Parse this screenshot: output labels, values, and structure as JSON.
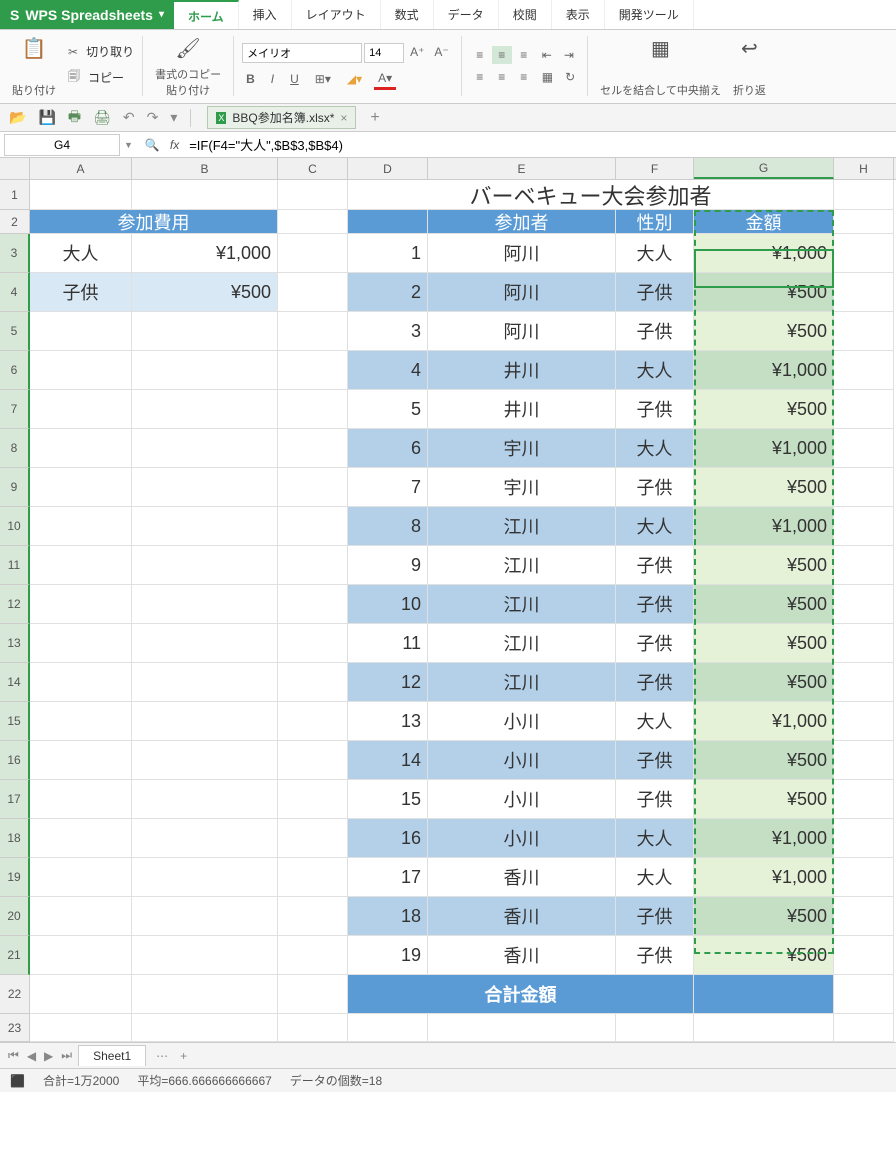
{
  "app": {
    "name": "WPS Spreadsheets"
  },
  "tabs": [
    "ホーム",
    "挿入",
    "レイアウト",
    "数式",
    "データ",
    "校閲",
    "表示",
    "開発ツール"
  ],
  "ribbon": {
    "paste": "貼り付け",
    "cut": "切り取り",
    "copy": "コピー",
    "format_paint": "書式のコピー\n貼り付け",
    "font_name": "メイリオ",
    "font_size": "14",
    "merge": "セルを結合して中央揃え",
    "wrap": "折り返"
  },
  "file": {
    "name": "BBQ参加名簿.xlsx*"
  },
  "namebox": "G4",
  "formula": "=IF(F4=\"大人\",$B$3,$B$4)",
  "col_headers": [
    "A",
    "B",
    "C",
    "D",
    "E",
    "F",
    "G",
    "H"
  ],
  "sheet": {
    "title": "バーベキュー大会参加者",
    "fee_header": "参加費用",
    "fee_rows": [
      {
        "label": "大人",
        "amount": "¥1,000"
      },
      {
        "label": "子供",
        "amount": "¥500"
      }
    ],
    "part_headers": {
      "d": "",
      "e": "参加者",
      "f": "性別",
      "g": "金額"
    },
    "rows": [
      {
        "n": "1",
        "name": "阿川",
        "type": "大人",
        "amt": "¥1,000"
      },
      {
        "n": "2",
        "name": "阿川",
        "type": "子供",
        "amt": "¥500"
      },
      {
        "n": "3",
        "name": "阿川",
        "type": "子供",
        "amt": "¥500"
      },
      {
        "n": "4",
        "name": "井川",
        "type": "大人",
        "amt": "¥1,000"
      },
      {
        "n": "5",
        "name": "井川",
        "type": "子供",
        "amt": "¥500"
      },
      {
        "n": "6",
        "name": "宇川",
        "type": "大人",
        "amt": "¥1,000"
      },
      {
        "n": "7",
        "name": "宇川",
        "type": "子供",
        "amt": "¥500"
      },
      {
        "n": "8",
        "name": "江川",
        "type": "大人",
        "amt": "¥1,000"
      },
      {
        "n": "9",
        "name": "江川",
        "type": "子供",
        "amt": "¥500"
      },
      {
        "n": "10",
        "name": "江川",
        "type": "子供",
        "amt": "¥500"
      },
      {
        "n": "11",
        "name": "江川",
        "type": "子供",
        "amt": "¥500"
      },
      {
        "n": "12",
        "name": "江川",
        "type": "子供",
        "amt": "¥500"
      },
      {
        "n": "13",
        "name": "小川",
        "type": "大人",
        "amt": "¥1,000"
      },
      {
        "n": "14",
        "name": "小川",
        "type": "子供",
        "amt": "¥500"
      },
      {
        "n": "15",
        "name": "小川",
        "type": "子供",
        "amt": "¥500"
      },
      {
        "n": "16",
        "name": "小川",
        "type": "大人",
        "amt": "¥1,000"
      },
      {
        "n": "17",
        "name": "香川",
        "type": "大人",
        "amt": "¥1,000"
      },
      {
        "n": "18",
        "name": "香川",
        "type": "子供",
        "amt": "¥500"
      },
      {
        "n": "19",
        "name": "香川",
        "type": "子供",
        "amt": "¥500"
      }
    ],
    "total_label": "合計金額"
  },
  "sheet_tab": "Sheet1",
  "status": {
    "sum": "合計=1万2000",
    "avg": "平均=666.666666666667",
    "count": "データの個数=18"
  }
}
